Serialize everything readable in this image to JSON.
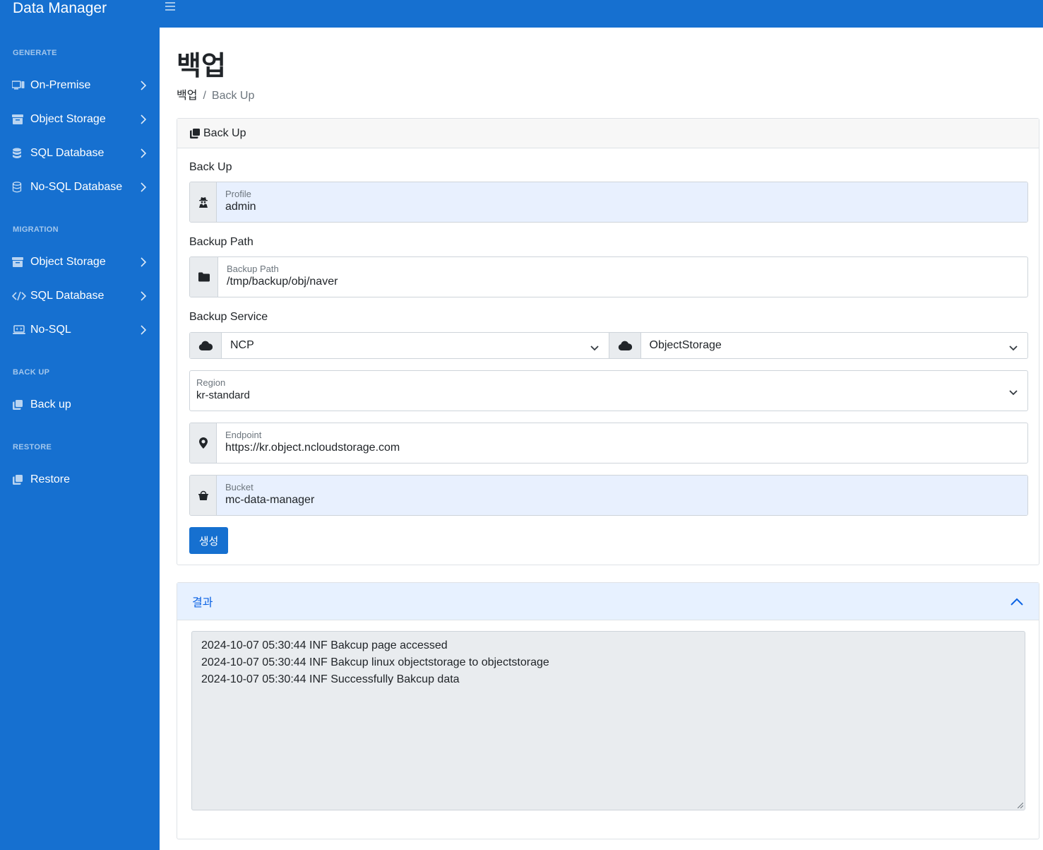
{
  "app": {
    "title": "Data Manager"
  },
  "sidebar": {
    "sections": [
      {
        "heading": "GENERATE"
      },
      {
        "heading": "MIGRATION"
      },
      {
        "heading": "BACK UP"
      },
      {
        "heading": "RESTORE"
      }
    ],
    "items": [
      {
        "label": "On-Premise",
        "icon": "monitor-icon"
      },
      {
        "label": "Object Storage",
        "icon": "archive-icon"
      },
      {
        "label": "SQL Database",
        "icon": "database-icon"
      },
      {
        "label": "No-SQL Database",
        "icon": "database-outline-icon"
      },
      {
        "label": "Object Storage",
        "icon": "archive-icon"
      },
      {
        "label": "SQL Database",
        "icon": "code-icon"
      },
      {
        "label": "No-SQL",
        "icon": "laptop-code-icon"
      },
      {
        "label": "Back up",
        "icon": "copy-icon"
      },
      {
        "label": "Restore",
        "icon": "copy-icon"
      }
    ]
  },
  "header": {
    "title": "백업",
    "breadcrumb": {
      "root": "백업",
      "sep": "/",
      "current": "Back Up"
    }
  },
  "card": {
    "header": "Back Up",
    "section_backup": "Back Up",
    "profile": {
      "label": "Profile",
      "value": "admin"
    },
    "section_path": "Backup Path",
    "path": {
      "label": "Backup Path",
      "value": "/tmp/backup/obj/naver"
    },
    "section_service": "Backup Service",
    "provider": {
      "value": "NCP"
    },
    "service": {
      "value": "ObjectStorage"
    },
    "region": {
      "label": "Region",
      "value": "kr-standard"
    },
    "endpoint": {
      "label": "Endpoint",
      "value": "https://kr.object.ncloudstorage.com"
    },
    "bucket": {
      "label": "Bucket",
      "value": "mc-data-manager"
    },
    "create_button": "생성"
  },
  "result": {
    "header": "결과",
    "logs": [
      "2024-10-07 05:30:44 INF Bakcup page accessed",
      "2024-10-07 05:30:44 INF Bakcup linux objectstorage to objectstorage",
      "2024-10-07 05:30:44 INF Successfully Bakcup data"
    ]
  },
  "colors": {
    "primary": "#1670d0",
    "accordion_bg": "#e7f1ff",
    "autofill_bg": "#e8f0fe"
  }
}
